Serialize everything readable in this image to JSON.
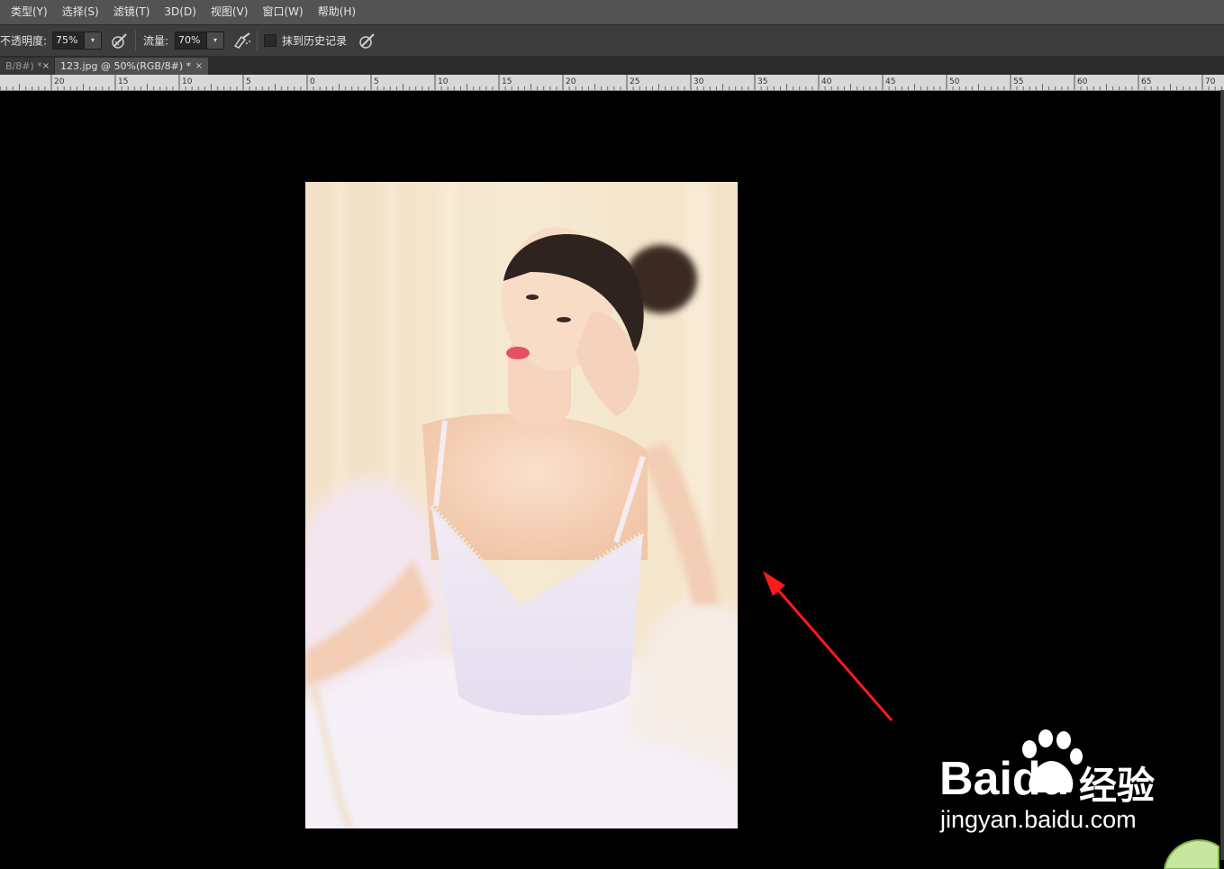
{
  "menu": [
    "类型(Y)",
    "选择(S)",
    "滤镜(T)",
    "3D(D)",
    "视图(V)",
    "窗口(W)",
    "帮助(H)"
  ],
  "options": {
    "opacity_label": "不透明度:",
    "opacity_value": "75%",
    "flow_label": "流量:",
    "flow_value": "70%",
    "erase_history_label": "抹到历史记录",
    "erase_history_checked": false
  },
  "tabs": [
    {
      "label": "B/8#) *",
      "active": false,
      "close": "×"
    },
    {
      "label": "123.jpg @ 50%(RGB/8#) *",
      "active": true,
      "close": "×"
    }
  ],
  "ruler": {
    "labels": [
      "20",
      "15",
      "10",
      "5",
      "0",
      "5",
      "10",
      "15",
      "20",
      "25",
      "30",
      "35",
      "40",
      "45",
      "50",
      "55",
      "60",
      "65",
      "70"
    ]
  },
  "canvas": {
    "image_description_icon": "ballerina-photo",
    "annotation_arrow_color": "#ff1a1a"
  },
  "watermark": {
    "brand": "Baidu",
    "brand_cn": "经验",
    "url": "jingyan.baidu.com"
  },
  "colors": {
    "menubar": "#535353",
    "optionsbar": "#3d3d3d",
    "canvas_bg": "#000000"
  }
}
